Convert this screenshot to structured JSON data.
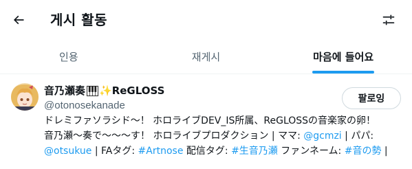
{
  "header": {
    "title": "게시 활동",
    "back_icon": "arrow-left-icon",
    "filter_icon": "sliders-icon"
  },
  "tabs": [
    {
      "label": "인용"
    },
    {
      "label": "재게시"
    },
    {
      "label": "마음에 들어요",
      "active": true
    }
  ],
  "user": {
    "name": "音乃瀬奏",
    "name_suffix": "✨ReGLOSS",
    "handle": "@otonosekanade",
    "follow_label": "팔로잉",
    "bio": {
      "line1": "ドレミファソラシド～！ ホロライブDEV_IS所属、ReGLOSSの音楽家の卵！",
      "line2a": "音乃瀬～奏で～～～す！ ホロライブプロダクション | ママ: ",
      "mama": "@gcmzi",
      "line2b": " | パパ:",
      "papa": "@otsukue",
      "line3a": " | FAタグ: ",
      "fa_tag": "#Artnose",
      "line3b": " 配信タグ: ",
      "stream_tag": "#生音乃瀬",
      "line3c": " ファンネーム: ",
      "fan_tag": "#音の勢",
      "line3d": " |"
    }
  },
  "colors": {
    "accent": "#1d9bf0",
    "text_primary": "#0f1419",
    "text_secondary": "#536471"
  }
}
